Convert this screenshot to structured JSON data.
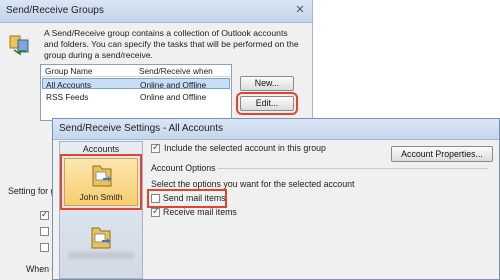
{
  "groups_window": {
    "title": "Send/Receive Groups",
    "close_glyph": "✕",
    "description": "A Send/Receive group contains a collection of Outlook accounts and folders. You can specify the tasks that will be performed on the group during a send/receive.",
    "columns": [
      "Group Name",
      "Send/Receive when"
    ],
    "rows": [
      {
        "name": "All Accounts",
        "when": "Online and Offline"
      },
      {
        "name": "RSS Feeds",
        "when": "Online and Offline"
      }
    ],
    "new_button": "New...",
    "edit_button": "Edit...",
    "setting_label": "Setting for g",
    "when_label": "When O"
  },
  "settings_window": {
    "title": "Send/Receive Settings - All Accounts",
    "accounts_header": "Accounts",
    "selected_account": "John Smith",
    "include_label": "Include the selected account in this group",
    "account_properties_button": "Account Properties...",
    "options_header": "Account Options",
    "options_prompt": "Select the options you want for the selected account",
    "send_mail_label": "Send mail items",
    "receive_mail_label": "Receive mail items"
  },
  "checkbox_states": {
    "include_account": true,
    "send_mail": false,
    "receive_mail": true
  },
  "colors": {
    "highlight": "#e2452e",
    "selection": "#c9ddf6",
    "title_bar": "#c6d6ec"
  }
}
